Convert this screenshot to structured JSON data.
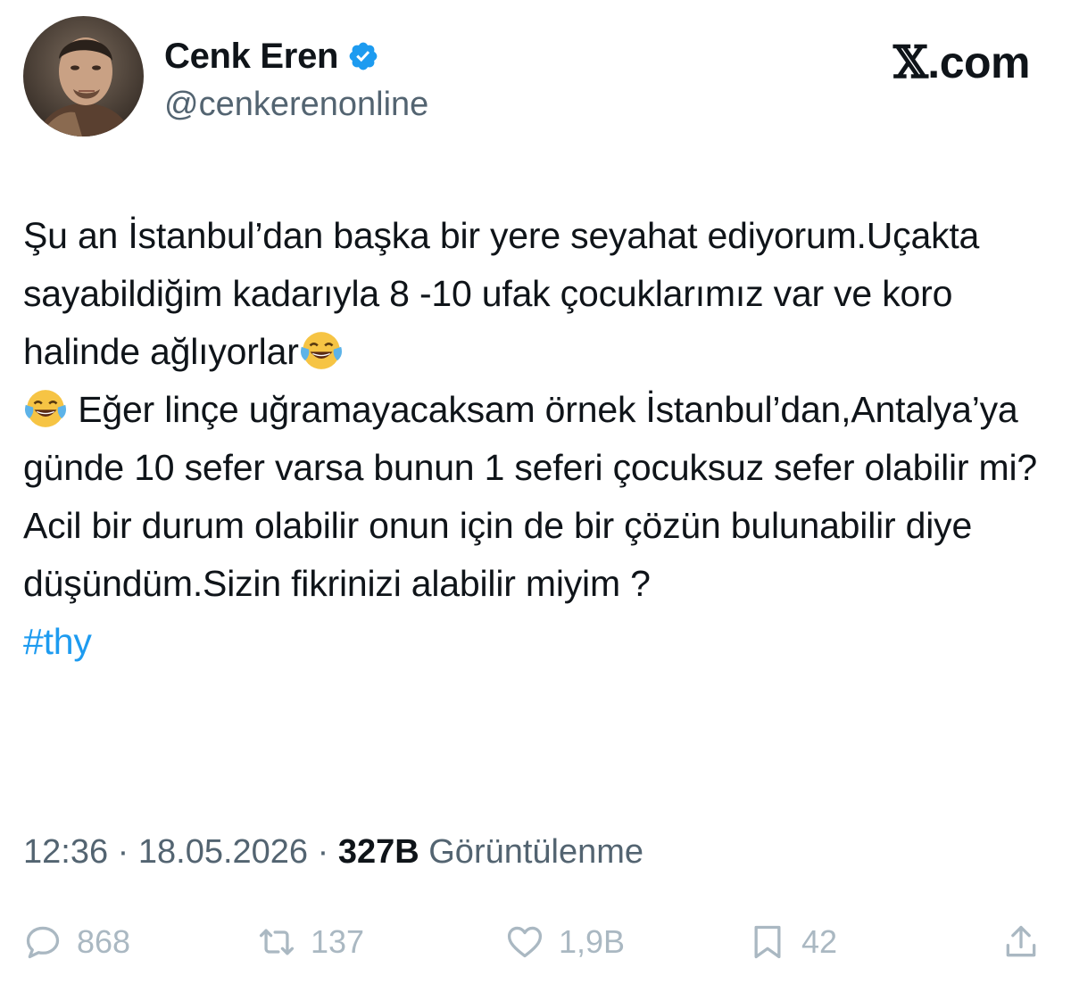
{
  "user": {
    "display_name": "Cenk Eren",
    "handle": "@cenkerenonline",
    "verified_icon": "verified-badge-icon",
    "avatar_icon": "avatar"
  },
  "brand": {
    "mark": "𝕏",
    "suffix": ".com"
  },
  "tweet": {
    "segments": [
      "Şu an İstanbul’dan başka bir yere seyahat ediyorum.Uçakta sayabildiğim kadarıyla 8 -10 ufak çocuklarımız var ve koro halinde ağlıyorlar",
      "Eğer linçe uğramayacaksam örnek İstanbul’dan,Antalya’ya günde 10 sefer varsa bunun 1 seferi çocuksuz sefer olabilir mi? Acil bir durum olabilir onun için de bir çözün bulunabilir diye düşündüm.Sizin fikrinizi alabilir miyim ?"
    ],
    "emoji_icon": "face-with-tears-of-joy-icon",
    "hashtag": "#thy"
  },
  "meta": {
    "time": "12:36",
    "separator": " · ",
    "date": "18.05.2026",
    "views_count": "327B",
    "views_label": "Görüntülenme"
  },
  "actions": {
    "replies": "868",
    "reposts": "137",
    "likes": "1,9B",
    "bookmarks": "42"
  },
  "colors": {
    "text": "#0f1419",
    "secondary": "#536471",
    "link": "#1d9bf0",
    "verified": "#1d9bf0",
    "action_icon": "#aab8c2"
  }
}
